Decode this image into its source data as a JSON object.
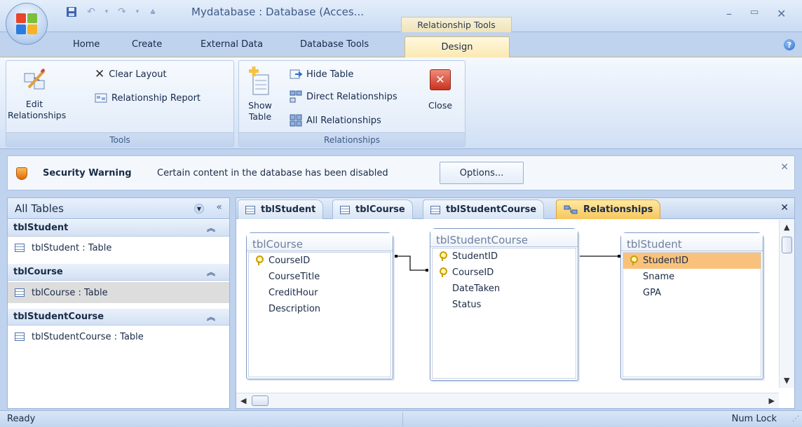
{
  "window": {
    "title": "Mydatabase : Database (Acces...",
    "context_tab": "Relationship Tools",
    "minimize_icon": "minimize-icon",
    "maximize_icon": "maximize-icon",
    "close_icon": "close-icon"
  },
  "ribbon_tabs": [
    "Home",
    "Create",
    "External Data",
    "Database Tools",
    "Design"
  ],
  "ribbon": {
    "tools": {
      "title": "Tools",
      "edit_relationships": "Edit Relationships",
      "clear_layout": "Clear Layout",
      "relationship_report": "Relationship Report"
    },
    "relationships": {
      "title": "Relationships",
      "show_table": "Show Table",
      "hide_table": "Hide Table",
      "direct_relationships": "Direct Relationships",
      "all_relationships": "All Relationships",
      "close": "Close"
    }
  },
  "security": {
    "title": "Security Warning",
    "message": "Certain content in the database has been disabled",
    "options": "Options..."
  },
  "nav": {
    "header": "All Tables",
    "groups": [
      {
        "name": "tblStudent",
        "item": "tblStudent : Table"
      },
      {
        "name": "tblCourse",
        "item": "tblCourse : Table"
      },
      {
        "name": "tblStudentCourse",
        "item": "tblStudentCourse : Table"
      }
    ]
  },
  "doc_tabs": [
    "tblStudent",
    "tblCourse",
    "tblStudentCourse",
    "Relationships"
  ],
  "tables": [
    {
      "name": "tblCourse",
      "fields": [
        {
          "label": "CourseID",
          "key": true
        },
        {
          "label": "CourseTitle",
          "key": false
        },
        {
          "label": "CreditHour",
          "key": false
        },
        {
          "label": "Description",
          "key": false
        }
      ]
    },
    {
      "name": "tblStudentCourse",
      "fields": [
        {
          "label": "StudentID",
          "key": true
        },
        {
          "label": "CourseID",
          "key": true
        },
        {
          "label": "DateTaken",
          "key": false
        },
        {
          "label": "Status",
          "key": false
        }
      ]
    },
    {
      "name": "tblStudent",
      "fields": [
        {
          "label": "StudentID",
          "key": true
        },
        {
          "label": "Sname",
          "key": false
        },
        {
          "label": "GPA",
          "key": false
        }
      ]
    }
  ],
  "status": {
    "left": "Ready",
    "right": "Num Lock"
  },
  "colors": {
    "accent_tab": "#f7c65c",
    "selected_field": "#f9c27c",
    "ribbon_bg": "#dce8f8"
  }
}
